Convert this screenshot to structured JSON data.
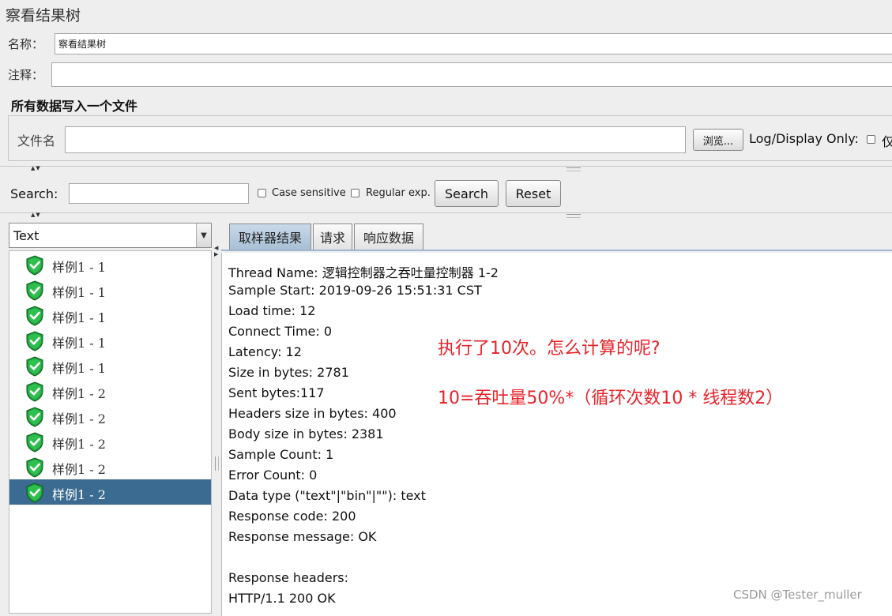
{
  "window_title": "察看结果树",
  "name_field": {
    "label": "名称：",
    "value": "察看结果树"
  },
  "comment_field": {
    "label": "注释：",
    "value": ""
  },
  "file_section": {
    "title": "所有数据写入一个文件",
    "file_label": "文件名",
    "file_value": "",
    "browse_label": "浏览...",
    "log_display_label": "Log/Display Only:",
    "only_label": "仅"
  },
  "search_bar": {
    "label": "Search:",
    "value": "",
    "case_sensitive_label": "Case sensitive",
    "regex_label": "Regular exp.",
    "search_button": "Search",
    "reset_button": "Reset"
  },
  "renderer": {
    "selected": "Text"
  },
  "tree_items": [
    {
      "label": "样例1 - 1",
      "status": "success",
      "selected": false
    },
    {
      "label": "样例1 - 1",
      "status": "success",
      "selected": false
    },
    {
      "label": "样例1 - 1",
      "status": "success",
      "selected": false
    },
    {
      "label": "样例1 - 1",
      "status": "success",
      "selected": false
    },
    {
      "label": "样例1 - 1",
      "status": "success",
      "selected": false
    },
    {
      "label": "样例1 - 2",
      "status": "success",
      "selected": false
    },
    {
      "label": "样例1 - 2",
      "status": "success",
      "selected": false
    },
    {
      "label": "样例1 - 2",
      "status": "success",
      "selected": false
    },
    {
      "label": "样例1 - 2",
      "status": "success",
      "selected": false
    },
    {
      "label": "样例1 - 2",
      "status": "success",
      "selected": true
    }
  ],
  "tabs": [
    {
      "label": "取样器结果",
      "active": true
    },
    {
      "label": "请求",
      "active": false
    },
    {
      "label": "响应数据",
      "active": false
    }
  ],
  "result": {
    "thread_name_key": "Thread Name:",
    "thread_name_value": "逻辑控制器之吞吐量控制器",
    "thread_name_suffix": "1-2",
    "lines": [
      "Sample Start: 2019-09-26 15:51:31 CST",
      "Load time: 12",
      "Connect Time: 0",
      "Latency: 12",
      "Size in bytes: 2781",
      "Sent bytes:117",
      "Headers size in bytes: 400",
      "Body size in bytes: 2381",
      "Sample Count: 1",
      "Error Count: 0",
      "Data type (\"text\"|\"bin\"|\"\"): text",
      "Response code: 200",
      "Response message: OK",
      "",
      "Response headers:",
      "HTTP/1.1 200 OK"
    ]
  },
  "annotations": {
    "line1": "执行了10次。怎么计算的呢?",
    "line2": "10=吞吐量50%*（循环次数10 * 线程数2）"
  },
  "watermark": "CSDN @Tester_muller",
  "colors": {
    "selection": "#3b6b91",
    "annotation": "#e8232a",
    "success_icon": "#1f9e3a"
  }
}
